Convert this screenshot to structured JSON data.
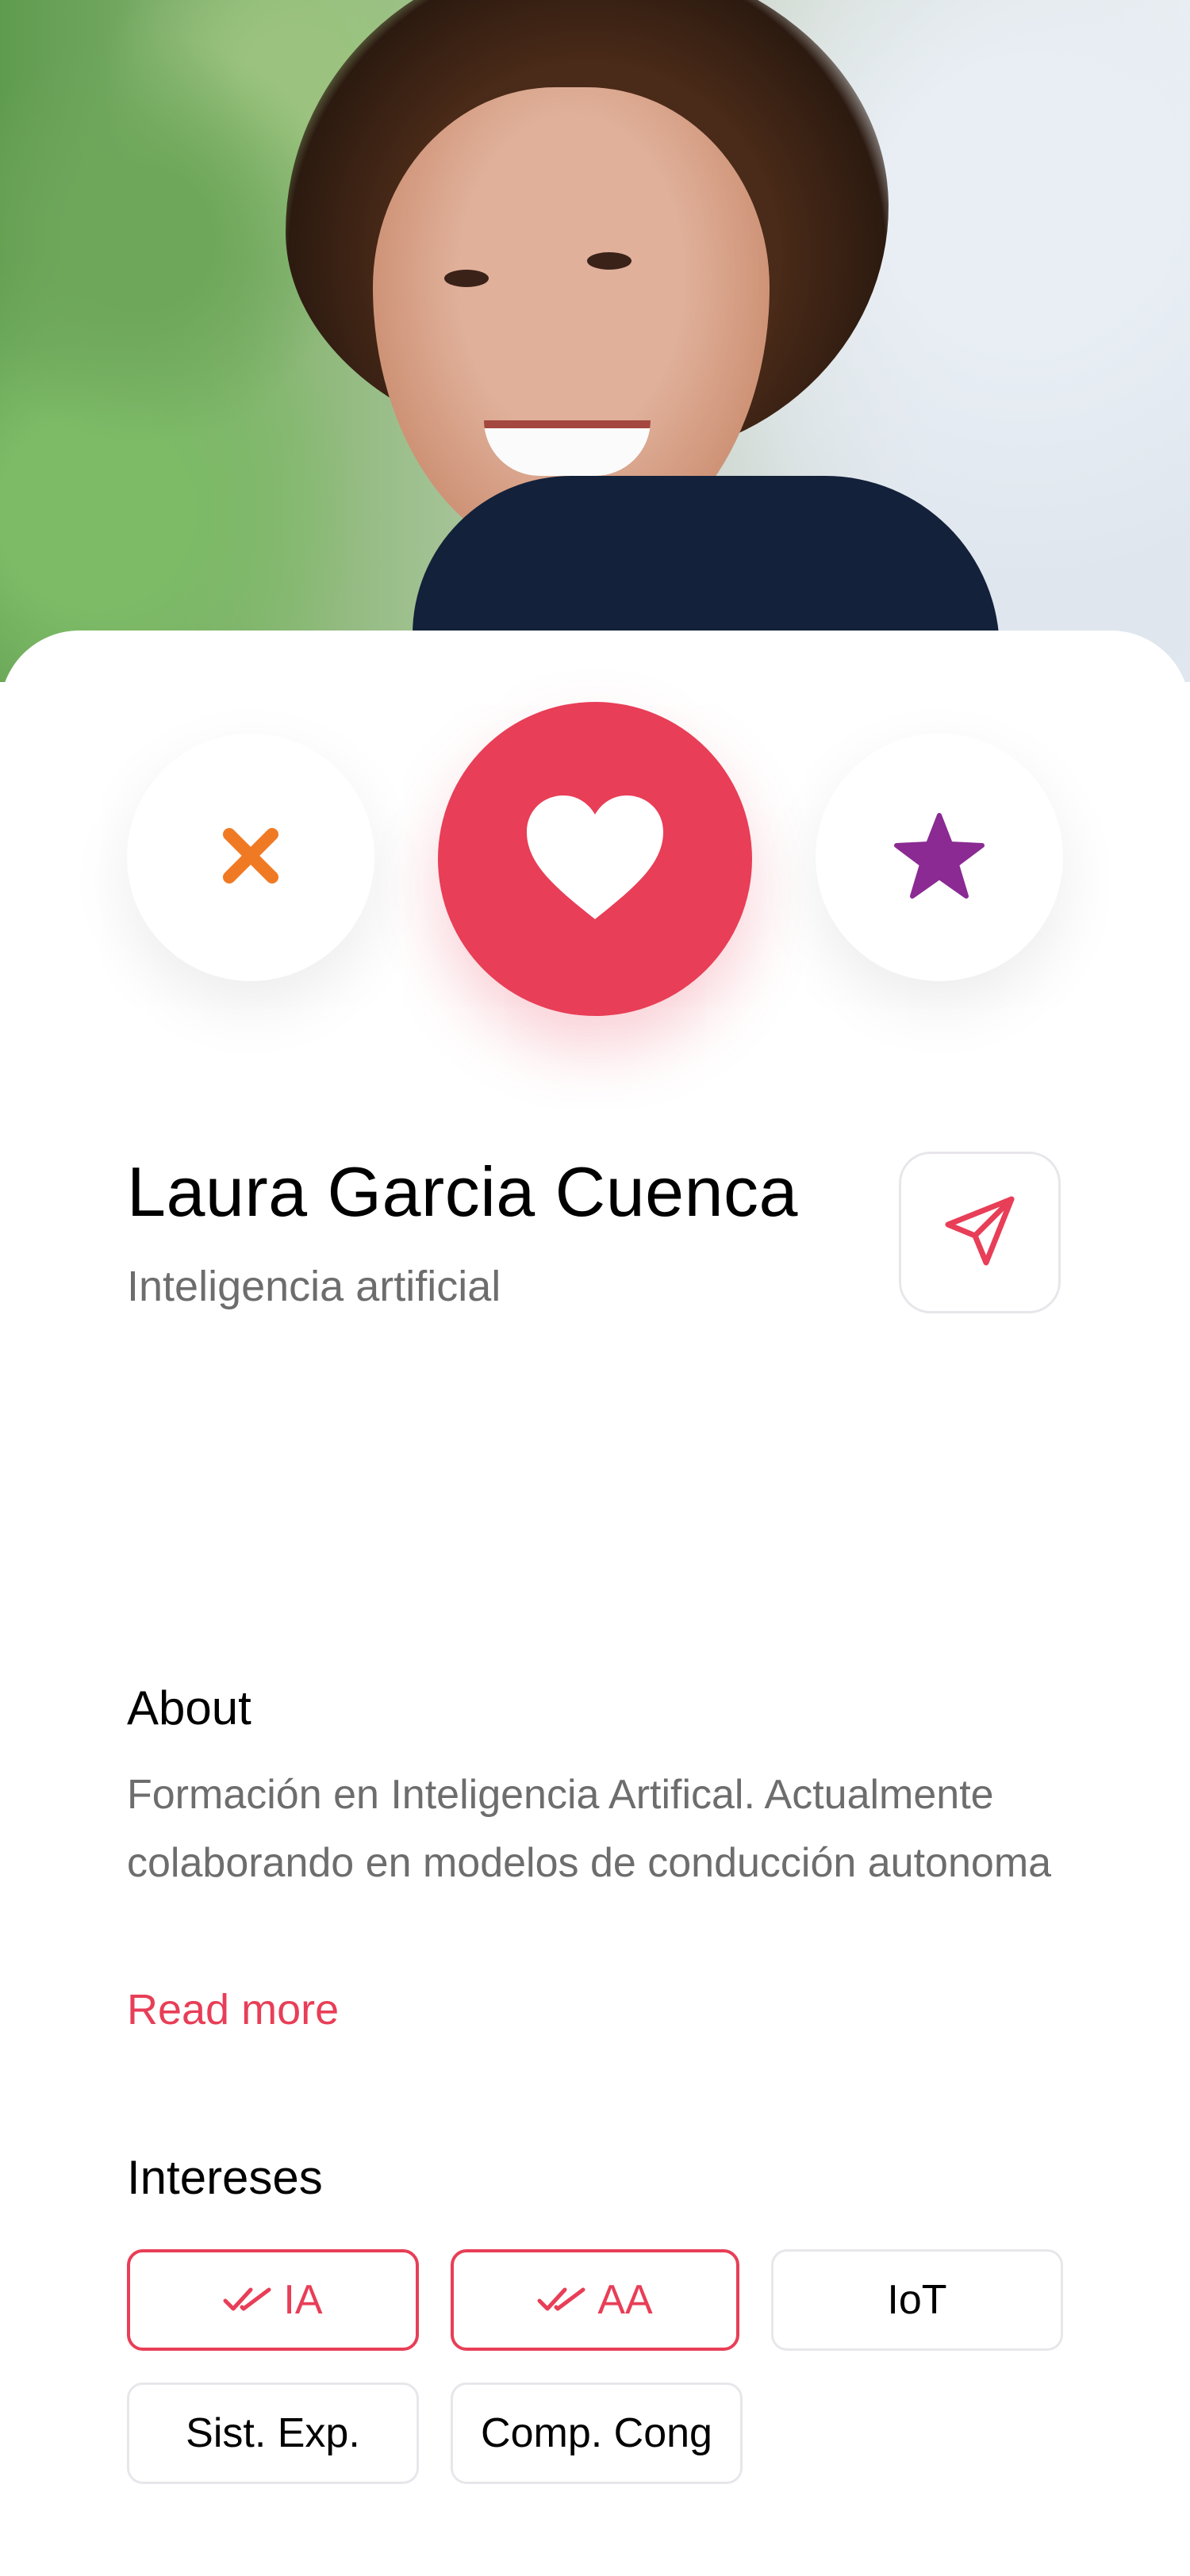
{
  "profile": {
    "name": "Laura Garcia Cuenca",
    "subtitle": "Inteligencia artificial"
  },
  "actions": {
    "dislike_icon": "close-icon",
    "like_icon": "heart-icon",
    "superlike_icon": "star-icon",
    "send_icon": "send-icon"
  },
  "about": {
    "title": "About",
    "text": "Formación en Inteligencia Artifical. Actualmente colaborando en modelos de conducción autonoma",
    "read_more": "Read more"
  },
  "interests": {
    "title": "Intereses",
    "items": [
      {
        "label": "IA",
        "selected": true
      },
      {
        "label": "AA",
        "selected": true
      },
      {
        "label": "IoT",
        "selected": false
      },
      {
        "label": "Sist. Exp.",
        "selected": false
      },
      {
        "label": "Comp. Cong",
        "selected": false
      }
    ]
  },
  "colors": {
    "accent": "#e83e57",
    "dislike": "#f07a24",
    "superlike": "#8a2a92",
    "text_secondary": "#6d6d6d",
    "chip_border": "#e8e6ea"
  }
}
